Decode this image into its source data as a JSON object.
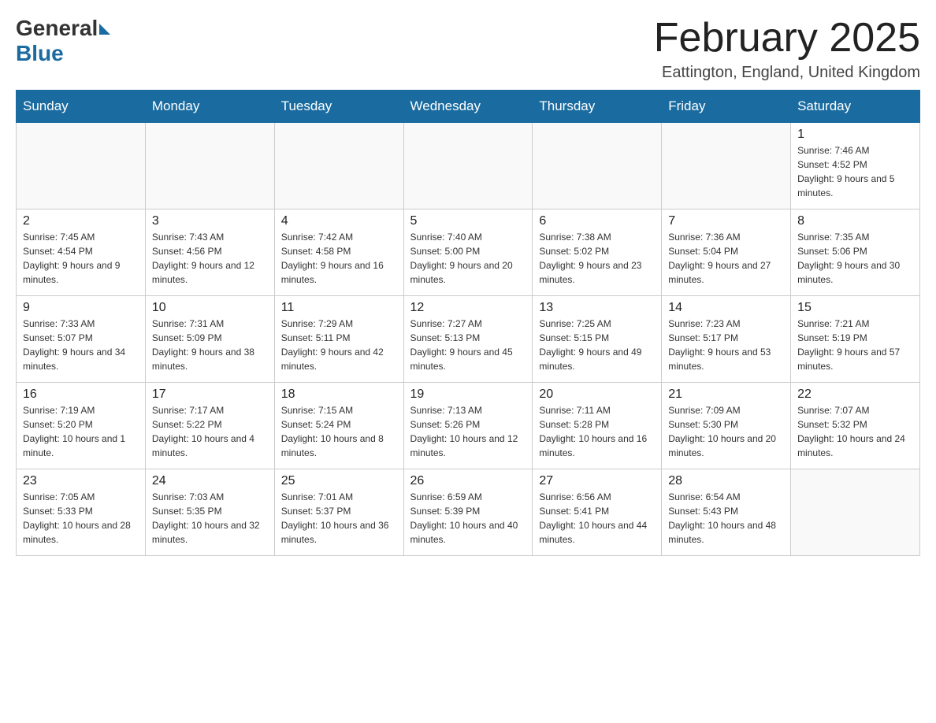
{
  "header": {
    "logo_general": "General",
    "logo_blue": "Blue",
    "month_title": "February 2025",
    "location": "Eattington, England, United Kingdom"
  },
  "days_of_week": [
    "Sunday",
    "Monday",
    "Tuesday",
    "Wednesday",
    "Thursday",
    "Friday",
    "Saturday"
  ],
  "weeks": [
    {
      "days": [
        {
          "number": "",
          "info": "",
          "empty": true
        },
        {
          "number": "",
          "info": "",
          "empty": true
        },
        {
          "number": "",
          "info": "",
          "empty": true
        },
        {
          "number": "",
          "info": "",
          "empty": true
        },
        {
          "number": "",
          "info": "",
          "empty": true
        },
        {
          "number": "",
          "info": "",
          "empty": true
        },
        {
          "number": "1",
          "info": "Sunrise: 7:46 AM\nSunset: 4:52 PM\nDaylight: 9 hours and 5 minutes.",
          "empty": false
        }
      ]
    },
    {
      "days": [
        {
          "number": "2",
          "info": "Sunrise: 7:45 AM\nSunset: 4:54 PM\nDaylight: 9 hours and 9 minutes.",
          "empty": false
        },
        {
          "number": "3",
          "info": "Sunrise: 7:43 AM\nSunset: 4:56 PM\nDaylight: 9 hours and 12 minutes.",
          "empty": false
        },
        {
          "number": "4",
          "info": "Sunrise: 7:42 AM\nSunset: 4:58 PM\nDaylight: 9 hours and 16 minutes.",
          "empty": false
        },
        {
          "number": "5",
          "info": "Sunrise: 7:40 AM\nSunset: 5:00 PM\nDaylight: 9 hours and 20 minutes.",
          "empty": false
        },
        {
          "number": "6",
          "info": "Sunrise: 7:38 AM\nSunset: 5:02 PM\nDaylight: 9 hours and 23 minutes.",
          "empty": false
        },
        {
          "number": "7",
          "info": "Sunrise: 7:36 AM\nSunset: 5:04 PM\nDaylight: 9 hours and 27 minutes.",
          "empty": false
        },
        {
          "number": "8",
          "info": "Sunrise: 7:35 AM\nSunset: 5:06 PM\nDaylight: 9 hours and 30 minutes.",
          "empty": false
        }
      ]
    },
    {
      "days": [
        {
          "number": "9",
          "info": "Sunrise: 7:33 AM\nSunset: 5:07 PM\nDaylight: 9 hours and 34 minutes.",
          "empty": false
        },
        {
          "number": "10",
          "info": "Sunrise: 7:31 AM\nSunset: 5:09 PM\nDaylight: 9 hours and 38 minutes.",
          "empty": false
        },
        {
          "number": "11",
          "info": "Sunrise: 7:29 AM\nSunset: 5:11 PM\nDaylight: 9 hours and 42 minutes.",
          "empty": false
        },
        {
          "number": "12",
          "info": "Sunrise: 7:27 AM\nSunset: 5:13 PM\nDaylight: 9 hours and 45 minutes.",
          "empty": false
        },
        {
          "number": "13",
          "info": "Sunrise: 7:25 AM\nSunset: 5:15 PM\nDaylight: 9 hours and 49 minutes.",
          "empty": false
        },
        {
          "number": "14",
          "info": "Sunrise: 7:23 AM\nSunset: 5:17 PM\nDaylight: 9 hours and 53 minutes.",
          "empty": false
        },
        {
          "number": "15",
          "info": "Sunrise: 7:21 AM\nSunset: 5:19 PM\nDaylight: 9 hours and 57 minutes.",
          "empty": false
        }
      ]
    },
    {
      "days": [
        {
          "number": "16",
          "info": "Sunrise: 7:19 AM\nSunset: 5:20 PM\nDaylight: 10 hours and 1 minute.",
          "empty": false
        },
        {
          "number": "17",
          "info": "Sunrise: 7:17 AM\nSunset: 5:22 PM\nDaylight: 10 hours and 4 minutes.",
          "empty": false
        },
        {
          "number": "18",
          "info": "Sunrise: 7:15 AM\nSunset: 5:24 PM\nDaylight: 10 hours and 8 minutes.",
          "empty": false
        },
        {
          "number": "19",
          "info": "Sunrise: 7:13 AM\nSunset: 5:26 PM\nDaylight: 10 hours and 12 minutes.",
          "empty": false
        },
        {
          "number": "20",
          "info": "Sunrise: 7:11 AM\nSunset: 5:28 PM\nDaylight: 10 hours and 16 minutes.",
          "empty": false
        },
        {
          "number": "21",
          "info": "Sunrise: 7:09 AM\nSunset: 5:30 PM\nDaylight: 10 hours and 20 minutes.",
          "empty": false
        },
        {
          "number": "22",
          "info": "Sunrise: 7:07 AM\nSunset: 5:32 PM\nDaylight: 10 hours and 24 minutes.",
          "empty": false
        }
      ]
    },
    {
      "days": [
        {
          "number": "23",
          "info": "Sunrise: 7:05 AM\nSunset: 5:33 PM\nDaylight: 10 hours and 28 minutes.",
          "empty": false
        },
        {
          "number": "24",
          "info": "Sunrise: 7:03 AM\nSunset: 5:35 PM\nDaylight: 10 hours and 32 minutes.",
          "empty": false
        },
        {
          "number": "25",
          "info": "Sunrise: 7:01 AM\nSunset: 5:37 PM\nDaylight: 10 hours and 36 minutes.",
          "empty": false
        },
        {
          "number": "26",
          "info": "Sunrise: 6:59 AM\nSunset: 5:39 PM\nDaylight: 10 hours and 40 minutes.",
          "empty": false
        },
        {
          "number": "27",
          "info": "Sunrise: 6:56 AM\nSunset: 5:41 PM\nDaylight: 10 hours and 44 minutes.",
          "empty": false
        },
        {
          "number": "28",
          "info": "Sunrise: 6:54 AM\nSunset: 5:43 PM\nDaylight: 10 hours and 48 minutes.",
          "empty": false
        },
        {
          "number": "",
          "info": "",
          "empty": true
        }
      ]
    }
  ]
}
